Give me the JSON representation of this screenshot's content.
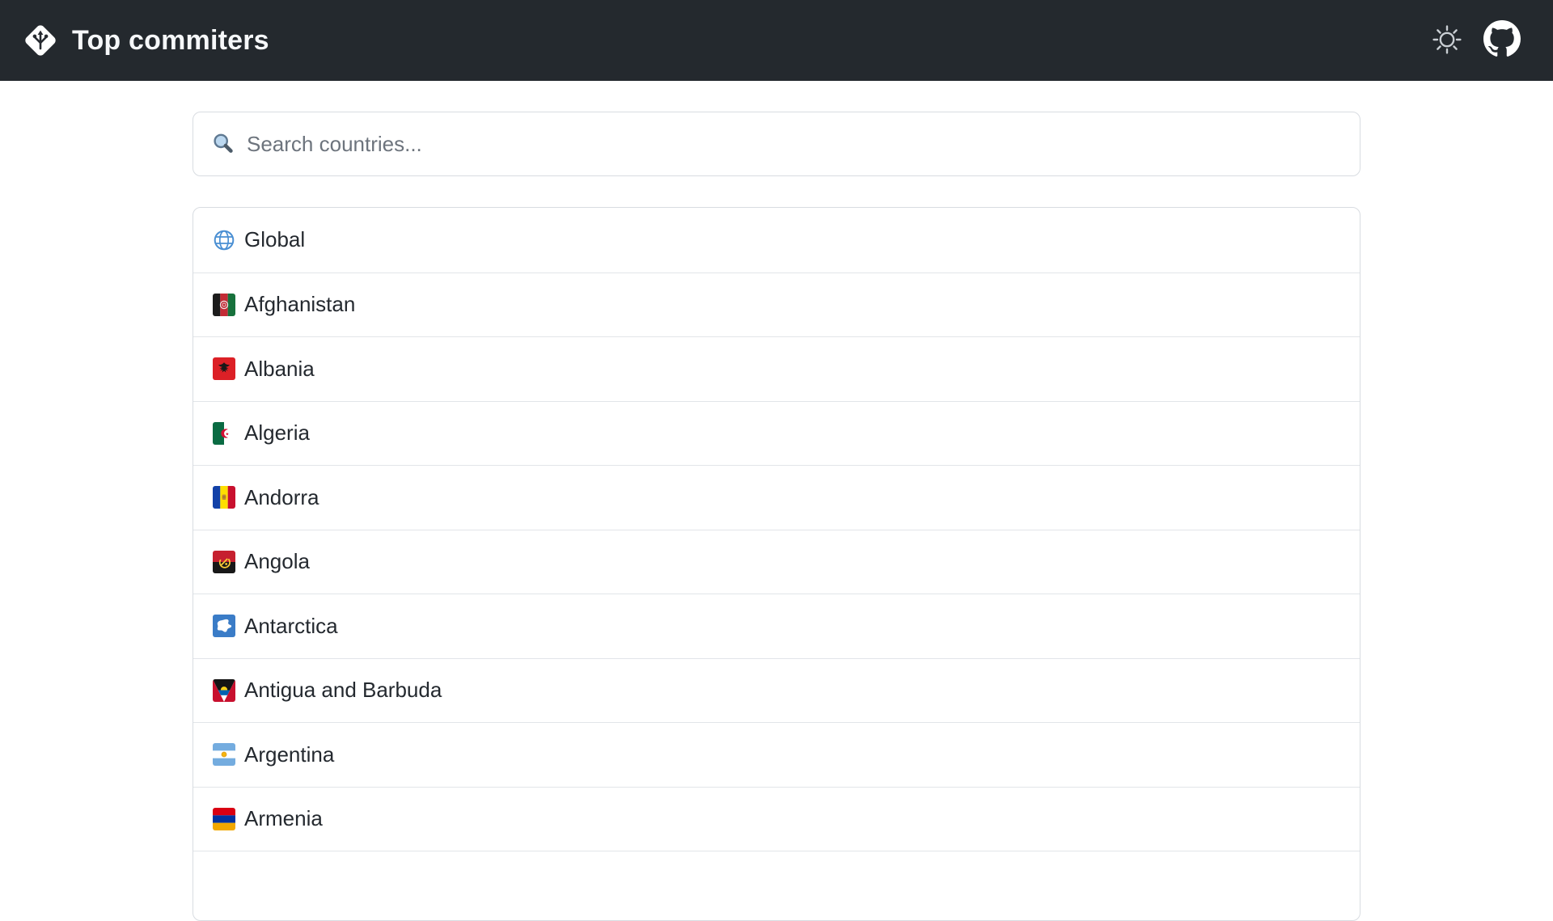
{
  "header": {
    "title": "Top commiters",
    "brand_icon": "git-diamond",
    "theme_icon": "sun",
    "github_icon": "github-mark"
  },
  "search": {
    "placeholder": "Search countries...",
    "value": "",
    "icon": "magnifier"
  },
  "countries": [
    {
      "name": "Global",
      "flag": "globe"
    },
    {
      "name": "Afghanistan",
      "flag": "af"
    },
    {
      "name": "Albania",
      "flag": "al"
    },
    {
      "name": "Algeria",
      "flag": "dz"
    },
    {
      "name": "Andorra",
      "flag": "ad"
    },
    {
      "name": "Angola",
      "flag": "ao"
    },
    {
      "name": "Antarctica",
      "flag": "aq"
    },
    {
      "name": "Antigua and Barbuda",
      "flag": "ag"
    },
    {
      "name": "Argentina",
      "flag": "ar"
    },
    {
      "name": "Armenia",
      "flag": "am"
    }
  ],
  "colors": {
    "header_bg": "#24292e",
    "header_text": "#f6f8fa",
    "card_border": "#d8dce1",
    "row_divider": "#e2e5e9",
    "text": "#24292f",
    "placeholder": "#6d747d",
    "globe_blue": "#4a8fd3"
  }
}
